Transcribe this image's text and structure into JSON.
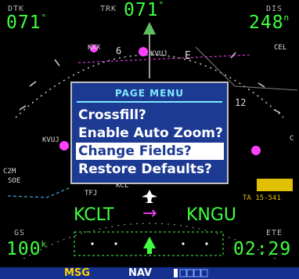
{
  "fields": {
    "dtk": {
      "label": "DTK",
      "value": "071",
      "unit": "°"
    },
    "trk": {
      "label": "TRK",
      "value": "071",
      "unit": "°"
    },
    "dis": {
      "label": "DIS",
      "value": "248",
      "unit": "n"
    },
    "gs": {
      "label": "GS",
      "value": "100",
      "unit": "k"
    },
    "ete": {
      "label": "ETE",
      "value": "02:29"
    }
  },
  "route": {
    "from": "KCLT",
    "arrow": "→",
    "to": "KNGU"
  },
  "map_labels": {
    "compass_6": "6",
    "compass_e": "E",
    "compass_12": "12",
    "wp_kvuj": "KVUJ",
    "wp_kvuj2": "KVUJ",
    "wp_cel": "CEL",
    "wp_kxx": "KXX",
    "wp_c": "C",
    "left1": "C2M",
    "left2": "SOE",
    "bottom_left": "TFJ",
    "bottom_mid": "KCL",
    "right_ta": "TA 15-541"
  },
  "page_menu": {
    "title": "PAGE MENU",
    "items": [
      {
        "label": "Crossfill?",
        "selected": false
      },
      {
        "label": "Enable Auto Zoom?",
        "selected": false
      },
      {
        "label": "Change Fields?",
        "selected": true
      },
      {
        "label": "Restore Defaults?",
        "selected": false
      }
    ]
  },
  "status_bar": {
    "msg": "MSG",
    "nav": "NAV"
  },
  "colors": {
    "field_green": "#3fff3f",
    "menu_background": "#1d3a93",
    "menu_title": "#7fe8ff",
    "status_bar": "#15308f",
    "msg": "#ffd400",
    "waypoint_magenta": "#ff40ff",
    "ownship": "#ffffff",
    "airspace_yellow": "#e0c000"
  }
}
